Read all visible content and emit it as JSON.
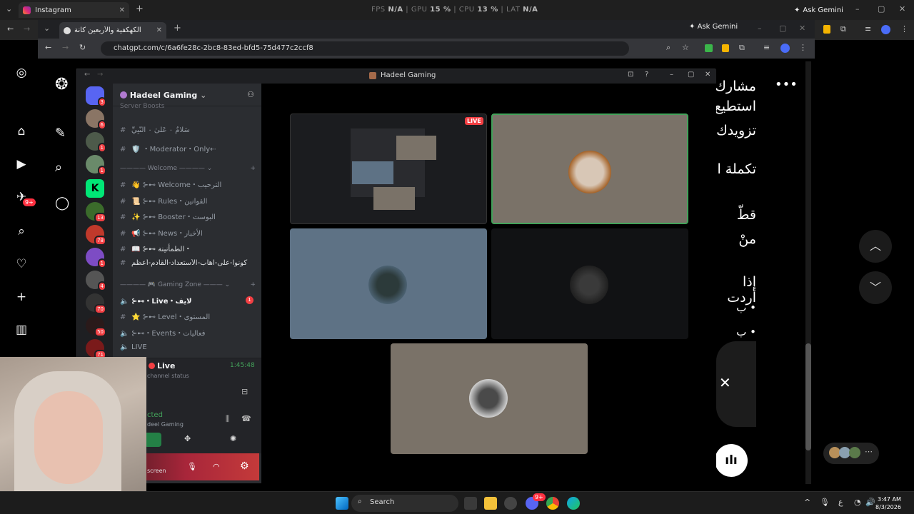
{
  "outer": {
    "tab_title": "Instagram",
    "perf": {
      "fps_label": "FPS",
      "fps": "N/A",
      "gpu_label": "GPU",
      "gpu": "15 %",
      "cpu_label": "CPU",
      "cpu": "13 %",
      "lat_label": "LAT",
      "lat": "N/A"
    },
    "ask_gemini": "Ask Gemini",
    "notif_badge": "9+"
  },
  "inner": {
    "tab_title": "الكهكفية والأربعين كانة",
    "url": "chatgpt.com/c/6a6fe28c-2bc8-83ed-bfd5-75d477c2ccf8",
    "ask_gemini": "Ask Gemini"
  },
  "chatgpt": {
    "lines": [
      "مشارك",
      "استطيع",
      "تزويدك",
      "تكملة ا",
      "قطّ",
      "منْ",
      "إذا أردت",
      "• ب",
      "• ب"
    ]
  },
  "discord": {
    "window_title": "Hadeel Gaming",
    "server_name": "Hadeel Gaming",
    "server_boosts": "Server Boosts",
    "channels": [
      {
        "icon": "#",
        "label": "سَلامٌ ۰ عَلَىٰ ۰ النَّبِيِّ"
      },
      {
        "icon": "#",
        "label": "🛡️ ・Moderator・Only⇠"
      },
      {
        "icon": "cat",
        "label": "Welcome"
      },
      {
        "icon": "#",
        "label": "👋 ⊱⊷ Welcome・الترحيب"
      },
      {
        "icon": "#",
        "label": "📜 ⊱⊷ Rules・القوانين"
      },
      {
        "icon": "#",
        "label": "✨ ⊱⊷ Booster・البوست"
      },
      {
        "icon": "#",
        "label": "📢 ⊱⊷ News・الأخبار"
      },
      {
        "icon": "#",
        "label": "📖 ⊱⊷ الطمأنينة・"
      },
      {
        "icon": "#",
        "label": "كونوا-على-اهاب-الأستعداد-القادم-أعظم"
      },
      {
        "icon": "cat",
        "label": "Gaming Zone"
      },
      {
        "icon": "vol",
        "label": "⊱⊷・Live・لايف"
      },
      {
        "icon": "#",
        "label": "⭐ ⊱⊷ Level・المستوى"
      },
      {
        "icon": "vol",
        "label": "⊱⊷・Events・فعاليات"
      },
      {
        "icon": "vol",
        "label": "LIVE"
      }
    ],
    "live_unread": "1",
    "voice": {
      "channel": "Live",
      "timer": "1:45:48",
      "status": "channel status",
      "connected": "cted",
      "server": "deel Gaming"
    },
    "user": {
      "sub": "screen"
    },
    "live_badge": "LIVE",
    "guild_badges": [
      "3",
      "6",
      "1",
      "1",
      "1",
      "13",
      "78",
      "1",
      "4",
      "70",
      "50",
      "71"
    ]
  },
  "taskbar": {
    "search": "Search",
    "lang": "ع",
    "time": "3:47 AM",
    "date": "8/3/2026",
    "discord_badge": "9+"
  },
  "colors": {
    "discord_bg": "#111214",
    "accent_green": "#43a25a",
    "live_red": "#f23f43",
    "stage_tile": "#7a7268"
  }
}
